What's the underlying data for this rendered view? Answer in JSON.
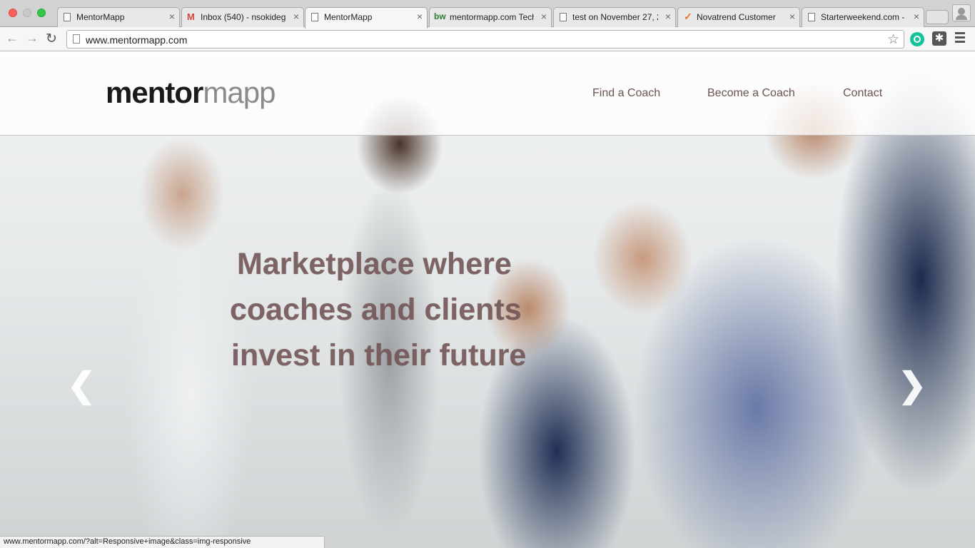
{
  "tabs": [
    {
      "title": "MentorMapp",
      "icon": "document-icon"
    },
    {
      "title": "Inbox (540) - nsokideg",
      "icon": "gmail-icon"
    },
    {
      "title": "MentorMapp",
      "icon": "document-icon",
      "active": true
    },
    {
      "title": "mentormapp.com Tech",
      "icon": "bw-icon",
      "icon_text": "bw"
    },
    {
      "title": "test on November 27, 2",
      "icon": "document-icon"
    },
    {
      "title": "Novatrend Customer",
      "icon": "check-icon"
    },
    {
      "title": "Starterweekend.com - ",
      "icon": "document-icon"
    }
  ],
  "toolbar": {
    "url": "www.mentormapp.com"
  },
  "site": {
    "logo_part1": "mentor",
    "logo_part2": "mapp",
    "nav": [
      "Find a Coach",
      "Become a Coach",
      "Contact"
    ]
  },
  "hero": {
    "lines": [
      "Marketplace where",
      "coaches and clients",
      "invest in their future"
    ]
  },
  "carousel": {
    "prev_glyph": "❮",
    "next_glyph": "❯"
  },
  "status_bar": "www.mentormapp.com/?alt=Responsive+image&class=img-responsive"
}
